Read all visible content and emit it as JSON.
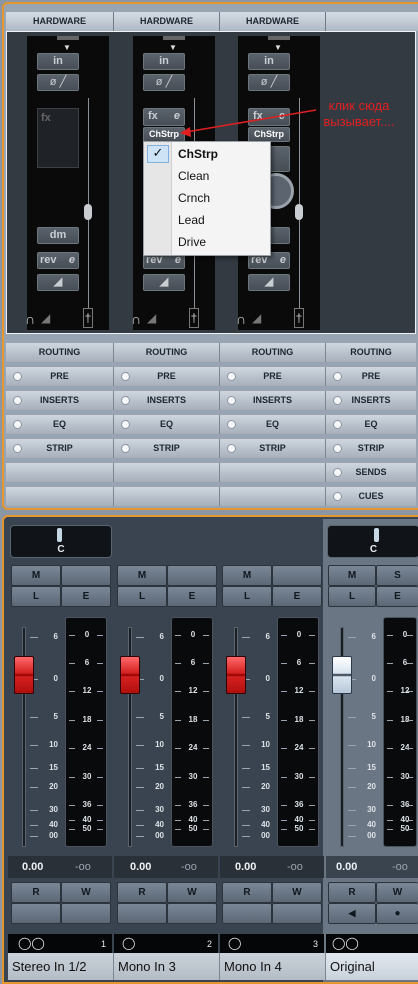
{
  "hardware": {
    "headers": [
      "HARDWARE",
      "HARDWARE",
      "HARDWARE"
    ],
    "buttons": {
      "input": "in",
      "phase": "ø",
      "fx": "fx",
      "edit": "e",
      "dm": "dm",
      "rev": "rev",
      "strip_label": "ChStrp",
      "dagger": "†"
    },
    "annotation": "клик сюда\nвызывает...."
  },
  "strip_menu": {
    "items": [
      {
        "label": "ChStrp",
        "checked": true
      },
      {
        "label": "Clean",
        "checked": false
      },
      {
        "label": "Crnch",
        "checked": false
      },
      {
        "label": "Lead",
        "checked": false
      },
      {
        "label": "Drive",
        "checked": false
      }
    ],
    "check_glyph": "✓"
  },
  "sections": {
    "routing": [
      "ROUTING",
      "ROUTING",
      "ROUTING",
      "ROUTING"
    ],
    "rows": [
      {
        "label": "PRE",
        "channels": 4
      },
      {
        "label": "INSERTS",
        "channels": 4
      },
      {
        "label": "EQ",
        "channels": 4
      },
      {
        "label": "STRIP",
        "channels": 4
      },
      {
        "label": "SENDS",
        "channels": 1
      },
      {
        "label": "CUES",
        "channels": 1
      }
    ]
  },
  "mixer": {
    "pan_label": "C",
    "buttons": {
      "mute": "M",
      "solo": "S",
      "listen": "L",
      "edit": "E",
      "read": "R",
      "write": "W"
    },
    "fader_scale": [
      "6",
      "0",
      "5",
      "10",
      "15",
      "20",
      "30",
      "40",
      "00"
    ],
    "meter_scale": [
      "0",
      "6",
      "12",
      "18",
      "24",
      "30",
      "36",
      "40",
      "50"
    ],
    "channels": [
      {
        "volume": "0.00",
        "peak": "-oo",
        "number": "1",
        "io_icon": "stereo",
        "name": "Stereo In 1/2",
        "fader_color": "red"
      },
      {
        "volume": "0.00",
        "peak": "-oo",
        "number": "2",
        "io_icon": "mono",
        "name": "Mono In 3",
        "fader_color": "red"
      },
      {
        "volume": "0.00",
        "peak": "-oo",
        "number": "3",
        "io_icon": "mono",
        "name": "Mono In 4",
        "fader_color": "red"
      },
      {
        "volume": "0.00",
        "peak": "-oo",
        "number": "",
        "io_icon": "stereo",
        "name": "Original",
        "fader_color": "white"
      }
    ]
  },
  "colors": {
    "frame_accent": "#e5962c",
    "annotation": "#e02020",
    "fader_red": "#d42020"
  }
}
